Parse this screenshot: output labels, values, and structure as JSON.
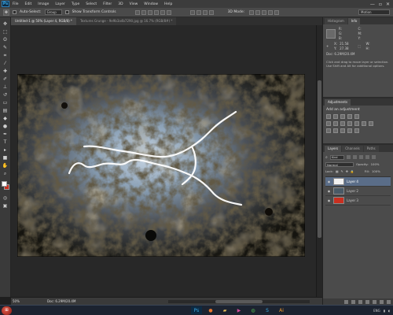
{
  "menubar": {
    "logo": "Ps",
    "items": [
      "File",
      "Edit",
      "Image",
      "Layer",
      "Type",
      "Select",
      "Filter",
      "3D",
      "View",
      "Window",
      "Help"
    ],
    "controls": [
      "—",
      "▫",
      "✕"
    ]
  },
  "options": {
    "auto_select_label": "Auto-Select:",
    "auto_select_value": "Group",
    "show_transform_label": "Show Transform Controls",
    "mode_3d_label": "3D Mode:",
    "workspace": "Motion"
  },
  "tabs": [
    "Untitled-1 @ 50% (Layer 4, RGB/8) *",
    "Textures Grunge - 9e9b3a4b7290.jpg @ 16.7% (RGB/8#) *"
  ],
  "status": {
    "zoom": "50%",
    "doc": "Doc: 6.29M/20.4M"
  },
  "panels": {
    "top_tabs": [
      "Histogram",
      "Info"
    ],
    "info": {
      "rgb": [
        "R:",
        "G:",
        "B:"
      ],
      "xy": [
        "X:",
        "Y:"
      ],
      "x_value": "21.58",
      "y_value": "27.38",
      "wh": [
        "W:",
        "H:"
      ],
      "doc": "Doc: 6.29M/20.4M",
      "hint": "Click and drag to move layer or selection. Use Shift and Alt for additional options."
    },
    "adjustments": {
      "tab": "Adjustments",
      "title": "Add an adjustment"
    },
    "layers": {
      "tabs": [
        "Layers",
        "Channels",
        "Paths"
      ],
      "filter": "Kind",
      "blend_mode": "Normal",
      "opacity_label": "Opacity:",
      "opacity": "100%",
      "lock_label": "Lock:",
      "fill_label": "Fill:",
      "fill": "100%",
      "items": [
        {
          "name": "Layer 4",
          "selected": true,
          "thumb": "#f2f2f2"
        },
        {
          "name": "Layer 2",
          "selected": false,
          "thumb": "#4a5a66"
        },
        {
          "name": "Layer 3",
          "selected": false,
          "thumb": "#c92f20"
        }
      ]
    }
  },
  "colors": {
    "foreground": "#ffffff",
    "background": "#c92f20",
    "accent": "#5a6d88"
  },
  "taskbar": {
    "icons": [
      "photoshop-icon",
      "firefox-icon",
      "folder-icon",
      "media-icon",
      "chrome-icon",
      "skype-icon",
      "illustrator-icon"
    ],
    "tray": "ENG"
  }
}
